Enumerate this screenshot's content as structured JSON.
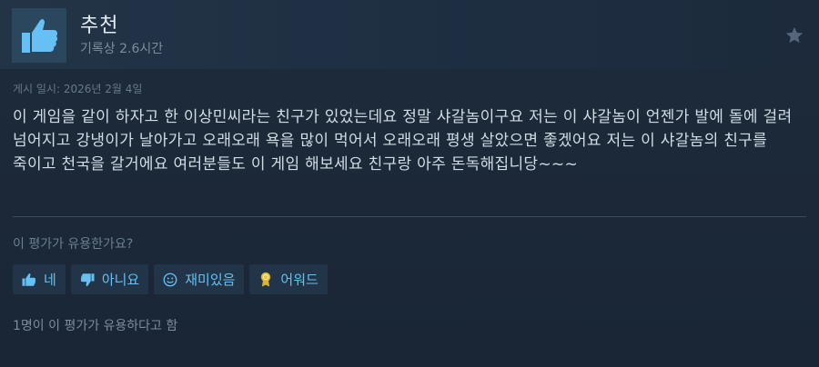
{
  "review": {
    "verdict": "추천",
    "hours": "기록상 2.6시간",
    "posted": "게시 일시: 2026년 2월 4일",
    "body": "이 게임을 같이 하자고 한 이상민씨라는 친구가 있었는데요 정말 샤갈놈이구요 저는 이 샤갈놈이 언젠가 발에 돌에 걸려 넘어지고 강냉이가 날아가고 오래오래 욕을 많이 먹어서 오래오래 평생 살았으면 좋겠어요 저는 이 샤갈놈의 친구를 죽이고 천국을 갈거에요 여러분들도 이 게임 해보세요 친구랑 아주 돈독해집니당~~~"
  },
  "feedback": {
    "question": "이 평가가 유용한가요?",
    "yes_label": "네",
    "no_label": "아니요",
    "funny_label": "재미있음",
    "award_label": "어워드",
    "helpful_count": "1명이 이 평가가 유용하다고 함"
  },
  "colors": {
    "background": "#1b2838",
    "accent": "#66c0f4",
    "thumb_bg": "#2a475e"
  },
  "icons": [
    "thumbs-up-icon",
    "star-icon",
    "thumbs-down-icon",
    "smiley-icon",
    "award-icon"
  ]
}
